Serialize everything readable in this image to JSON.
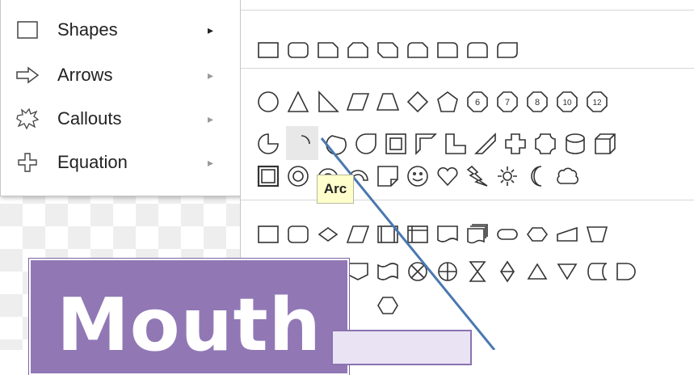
{
  "menu": {
    "items": [
      {
        "label": "Shapes",
        "icon": "square-icon",
        "has_submenu": true,
        "active": true
      },
      {
        "label": "Arrows",
        "icon": "arrow-right-icon",
        "has_submenu": true,
        "active": false
      },
      {
        "label": "Callouts",
        "icon": "explosion-callout-icon",
        "has_submenu": true,
        "active": false
      },
      {
        "label": "Equation",
        "icon": "plus-outline-icon",
        "has_submenu": true,
        "active": false
      }
    ],
    "submenu_arrow": "▸"
  },
  "submenu": {
    "groups": [
      {
        "name": "rectangles",
        "shapes": [
          "rectangle",
          "rounded-rectangle",
          "snip-single-corner",
          "snip-same-side",
          "snip-diagonal",
          "round-snip-corner",
          "round-single-corner",
          "round-same-side",
          "round-diagonal"
        ]
      },
      {
        "name": "basic",
        "shapes": [
          "oval",
          "triangle",
          "right-triangle",
          "parallelogram",
          "trapezoid",
          "diamond",
          "pentagon",
          "hexagon-6",
          "heptagon-7",
          "octagon-8",
          "decagon-10",
          "dodecagon-12",
          "pie",
          "arc",
          "chord",
          "teardrop",
          "frame",
          "half-frame",
          "l-shape",
          "diagonal-stripe",
          "cross",
          "plaque",
          "can",
          "cube",
          "bevel",
          "donut",
          "block-arc",
          "folded-corner",
          "smiley",
          "heart",
          "lightning",
          "sun",
          "moon",
          "cloud"
        ]
      },
      {
        "name": "flowchart",
        "shapes": [
          "process",
          "alternate-process",
          "decision",
          "data",
          "predefined-process",
          "internal-storage",
          "document",
          "multidocument",
          "terminator",
          "preparation",
          "manual-input",
          "manual-operation",
          "connector",
          "offpage",
          "punched-tape",
          "summing-junction",
          "or",
          "collate",
          "sort",
          "extract",
          "merge",
          "stored-data",
          "delay",
          "sequential-access",
          "magnetic-disk"
        ]
      }
    ],
    "badge_numbers": [
      "6",
      "7",
      "8",
      "10",
      "12"
    ]
  },
  "tooltip": {
    "text": "Arc"
  },
  "canvas": {
    "mouth_label": "Mouth",
    "colors": {
      "label_fill": "#9178b5",
      "connector": "#4a78b0",
      "small_box": "#e9e3f3"
    }
  }
}
